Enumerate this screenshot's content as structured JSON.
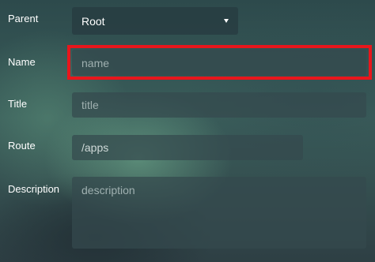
{
  "form": {
    "parent": {
      "label": "Parent",
      "selected": "Root"
    },
    "name": {
      "label": "Name",
      "placeholder": "name",
      "value": ""
    },
    "title": {
      "label": "Title",
      "placeholder": "title",
      "value": ""
    },
    "route": {
      "label": "Route",
      "placeholder": "",
      "value": "/apps"
    },
    "description": {
      "label": "Description",
      "placeholder": "description",
      "value": ""
    }
  },
  "colors": {
    "highlight": "#e8161c",
    "field_background": "#344a4e",
    "label_text": "#ffffff",
    "placeholder_text": "#9fb0b0"
  },
  "icons": {
    "parent_dropdown": "caret-down-icon"
  }
}
